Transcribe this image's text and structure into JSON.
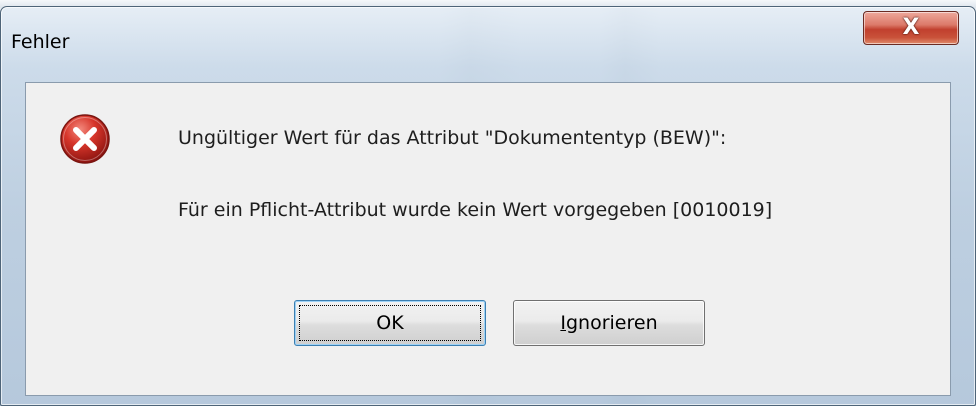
{
  "window": {
    "title": "Fehler",
    "close_glyph": "X"
  },
  "message": {
    "line1": "Ungültiger Wert für das Attribut \"Dokumententyp (BEW)\":",
    "line2": "Für ein Pflicht-Attribut wurde kein Wert vorgegeben [0010019]"
  },
  "buttons": {
    "ok_label": "OK",
    "ignore_label": "Ignorieren"
  },
  "icons": {
    "error": "error-icon",
    "close": "close-icon"
  },
  "colors": {
    "error_red": "#c8231c",
    "close_button": "#c1402e",
    "focus_border": "#3c7fb1"
  }
}
